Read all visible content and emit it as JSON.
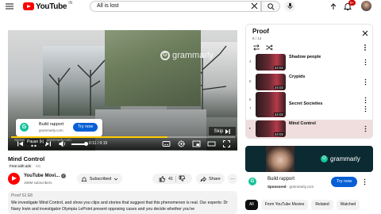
{
  "header": {
    "logo_text": "YouTube",
    "logo_region": "IN",
    "search_value": "All is lost",
    "notifications_badge": "9+"
  },
  "player": {
    "watermark": "grammarly",
    "ad_card": {
      "title": "Build rapport",
      "url": "grammarly.com",
      "cta": "Try now"
    },
    "sponsored": "Sponsored · 1 of 2 · grammarly.com",
    "pause_tooltip": "Pause (k)",
    "skip_label": "Skip",
    "time": "0:11 / 0:15",
    "ad_progress": 0.7,
    "volume": 0.9
  },
  "video": {
    "title": "Mind Control",
    "badges": [
      "Free with ads",
      "CC"
    ],
    "channel": "YouTube Movi...",
    "subscribers": "190M subscribers",
    "subscribed_label": "Subscribed",
    "likes": "41",
    "share_label": "Share",
    "description_meta": "Proof  S1 E8",
    "description": "We investigate Mind Control, and show you clips and stories that suggest that this phenomenon is real. Our experts: Dr Nany Irwin and investigator Olympia LePoint present opposing cases and you decide whether you've"
  },
  "playlist": {
    "title": "Proof",
    "count": "8 / 13",
    "items": [
      {
        "num": "4",
        "title": "Shadow people",
        "duration": "24:02"
      },
      {
        "num": "5",
        "title": "Crypids",
        "duration": "24:02"
      },
      {
        "num": "6",
        "title": "",
        "duration": "24:02"
      },
      {
        "num": "7",
        "title": "Secret Societies",
        "duration": "24:02"
      },
      {
        "num": "",
        "title": "Mind Control",
        "duration": "24:02"
      }
    ]
  },
  "side_ad": {
    "brand": "grammarly",
    "title": "Build rapport",
    "sponsored": "Sponsored",
    "url": "grammarly.com",
    "cta": "Try now"
  },
  "chips": [
    "All",
    "From YouTube Movies",
    "Related",
    "Watched"
  ]
}
